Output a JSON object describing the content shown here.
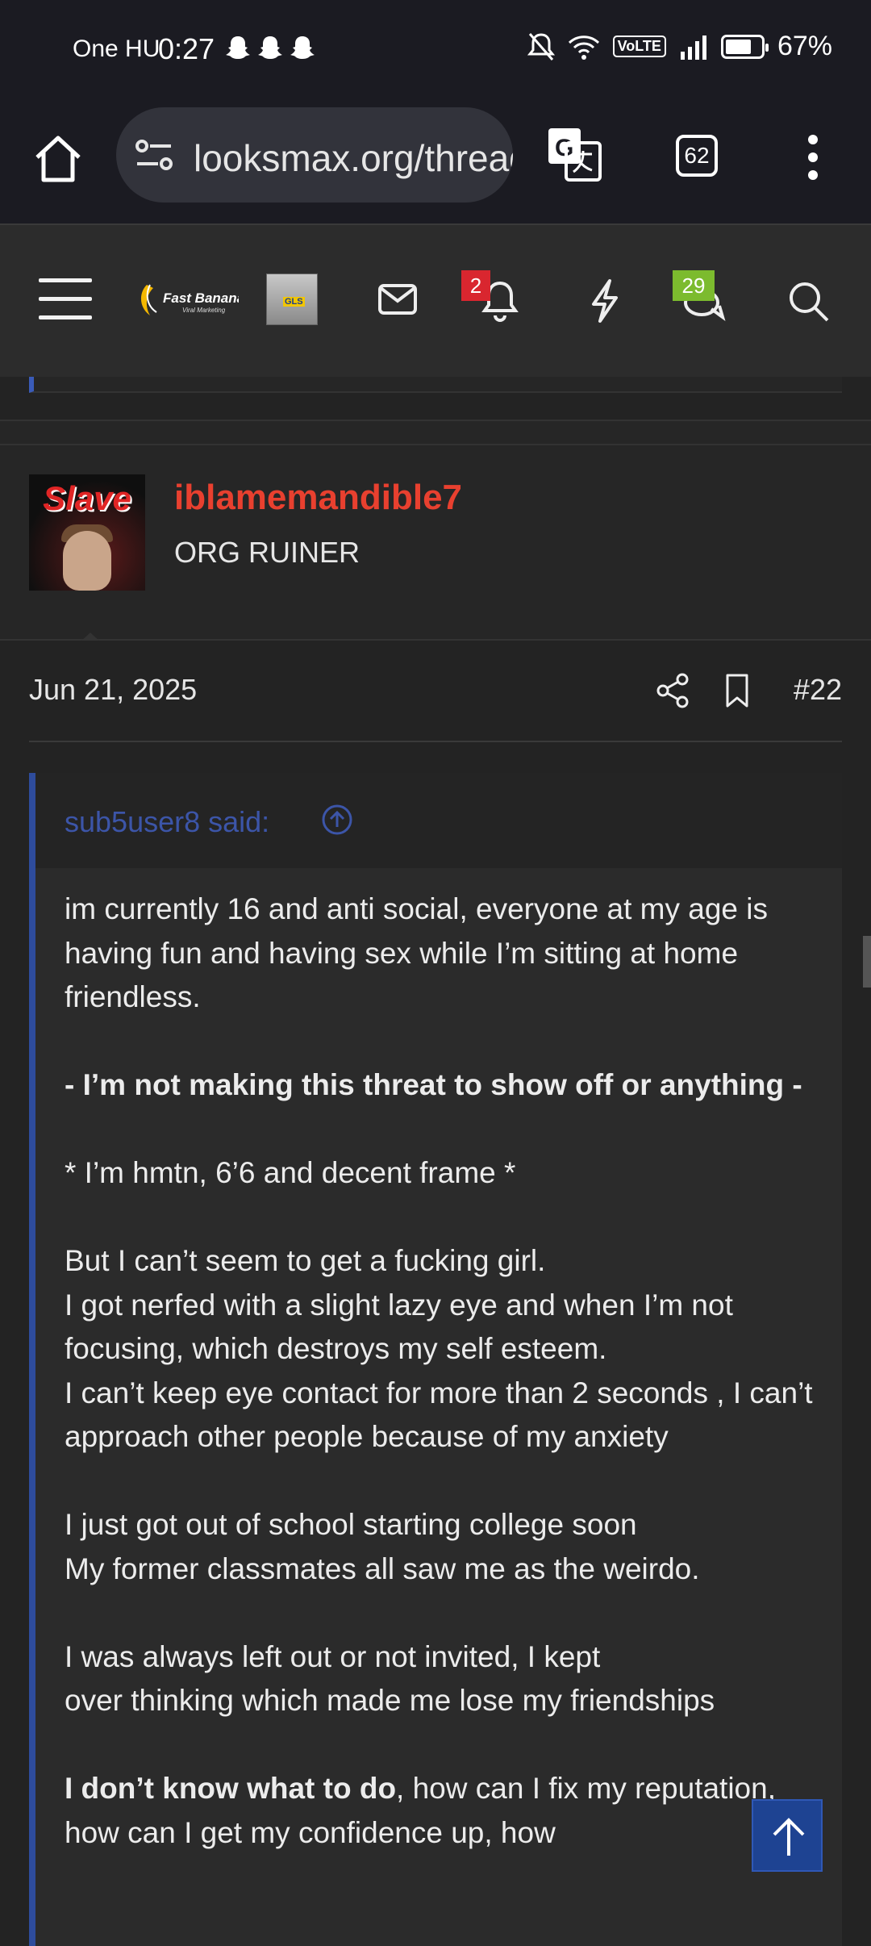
{
  "status_bar": {
    "carrier": "One HU",
    "time": "0:27",
    "notifications": "☃ ☃ ☃",
    "volte": "VoLTE",
    "battery": "67%",
    "battery_level": 0.67
  },
  "browser": {
    "url": "looksmax.org/threads",
    "tab_count": "62"
  },
  "forum_header": {
    "logo_name": "Fast Banana",
    "logo_tagline": "Viral Marketing",
    "notification_count": "2",
    "conversation_count": "29",
    "accent_colors": {
      "alert_badge": "#d9262f",
      "conversation_badge": "#7cbb2e"
    }
  },
  "post": {
    "avatar_text": "Slave",
    "username": "iblamemandible7",
    "user_title": "ORG RUINER",
    "date": "Jun 21, 2025",
    "number": "#22",
    "quote": {
      "author_line": "sub5user8 said:",
      "paragraphs": [
        "im currently 16 and anti social, everyone at my age is having fun and having sex while I’m sitting at home friendless.",
        "- I’m not making this threat to show off or anything -",
        "* I’m hmtn, 6’6 and decent frame *",
        "But I can’t seem to get a fucking girl.",
        "I got nerfed with a slight lazy eye and when I’m not focusing, which destroys my self esteem.",
        "I can’t keep eye contact for more than 2 seconds , I can’t approach other people because of my anxiety",
        "I just got out of school starting college soon",
        "My former classmates all saw me as the weirdo.",
        "I was always left out or not invited, I kept",
        "over thinking which made me lose my friendships",
        "I don’t know what to do",
        ", how can I fix my reputation, how can I get my confidence up, how"
      ]
    }
  }
}
